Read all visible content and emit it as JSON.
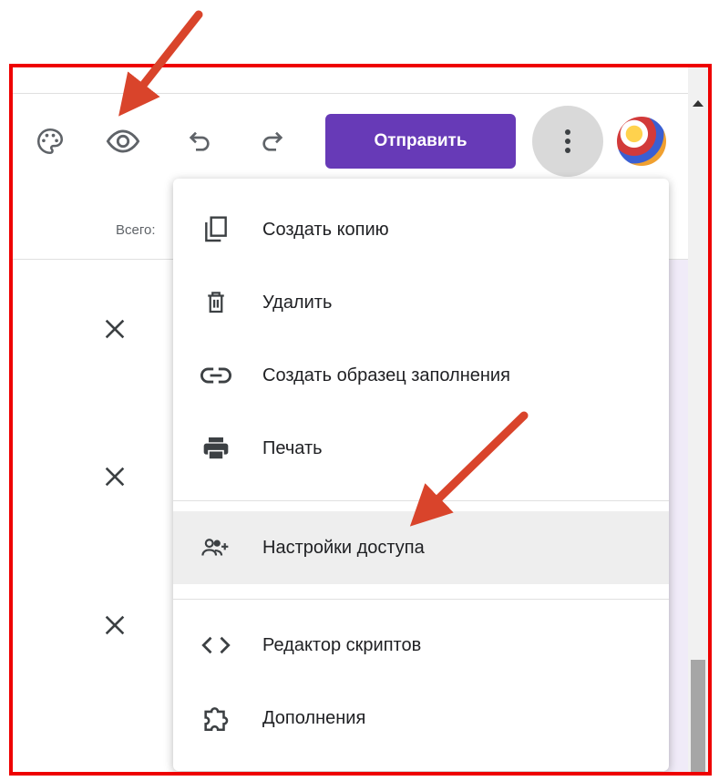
{
  "toolbar": {
    "send_label": "Отправить",
    "icons": [
      "palette-icon",
      "eye-icon",
      "undo-icon",
      "redo-icon",
      "more-vert-icon"
    ]
  },
  "form": {
    "total_label": "Всего:"
  },
  "menu": {
    "items": [
      {
        "label": "Создать копию",
        "icon": "copy-icon"
      },
      {
        "label": "Удалить",
        "icon": "trash-icon"
      },
      {
        "label": "Создать образец заполнения",
        "icon": "link-icon"
      },
      {
        "label": "Печать",
        "icon": "print-icon"
      },
      {
        "label": "Настройки доступа",
        "icon": "add-people-icon",
        "highlighted": true
      },
      {
        "label": "Редактор скриптов",
        "icon": "code-icon"
      },
      {
        "label": "Дополнения",
        "icon": "puzzle-icon"
      }
    ]
  },
  "colors": {
    "frame_border": "#ee0000",
    "send_button": "#673ab7",
    "annotation_arrow": "#d9442b",
    "highlight_row": "#eeeeee"
  }
}
